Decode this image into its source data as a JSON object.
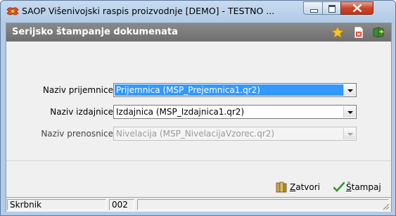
{
  "window": {
    "title": "SAOP Višenivojski raspis proizvodnje [DEMO] - TESTNO ...",
    "controls": {
      "minimize": "minimize",
      "maximize": "maximize",
      "close": "close"
    }
  },
  "header": {
    "title": "Serijsko štampanje dokumenata",
    "icons": [
      "star-icon",
      "pdf-document-icon",
      "book-exit-icon"
    ]
  },
  "form": {
    "rows": [
      {
        "label": "Naziv prijemnice",
        "value": "Prijemnica  (MSP_Prejemnica1.qr2)",
        "state": "selected"
      },
      {
        "label": "Naziv izdajnice",
        "value": "Izdajnica  (MSP_Izdajnica1.qr2)",
        "state": "normal"
      },
      {
        "label": "Naziv prenosnice",
        "value": "Nivelacija  (MSP_NivelacijaVzorec.qr2)",
        "state": "disabled"
      }
    ]
  },
  "buttons": {
    "close": {
      "mnemonic": "Z",
      "rest": "atvori",
      "icon": "books-close-icon"
    },
    "print": {
      "mnemonic": "Š",
      "rest": "tampaj",
      "icon": "checkmark-icon"
    }
  },
  "statusbar": {
    "panel1": "Skrbnik",
    "panel2": "002",
    "panel3": ""
  },
  "colors": {
    "selection": "#3399ff",
    "header_bg": "#767676",
    "close_button": "#c9462c",
    "check_green": "#2a9a2a"
  }
}
